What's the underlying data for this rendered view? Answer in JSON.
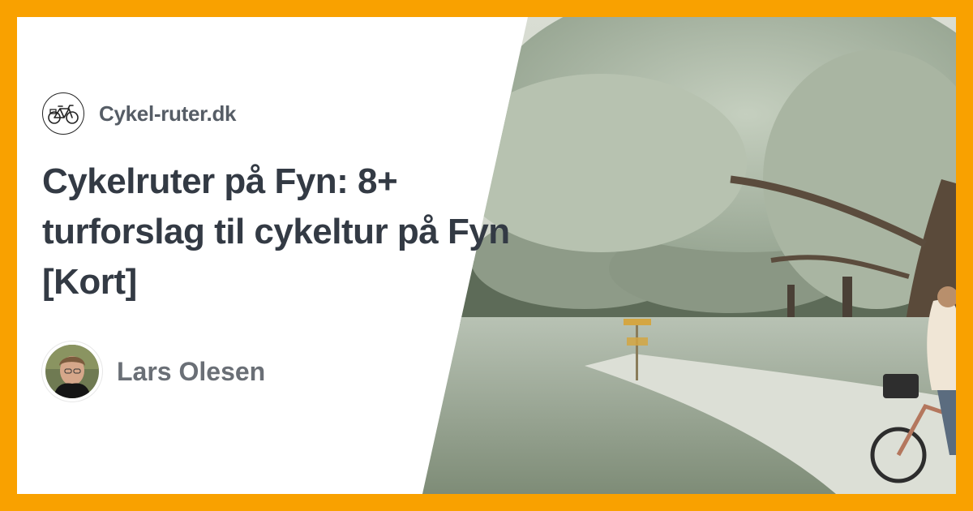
{
  "site": {
    "logo_icon": "bicycle-icon",
    "name": "Cykel-ruter.dk"
  },
  "article": {
    "title": "Cykelruter på Fyn: 8+ turforslag til cykeltur på Fyn [Kort]"
  },
  "author": {
    "name": "Lars Olesen",
    "avatar_icon": "author-portrait"
  },
  "hero_image": {
    "description_icon": "park-cyclist-photo"
  },
  "colors": {
    "frame": "#f9a100",
    "card_background": "#ffffff",
    "title_text": "#333a44",
    "brand_text": "#565d66",
    "author_text": "#6a6f76"
  }
}
